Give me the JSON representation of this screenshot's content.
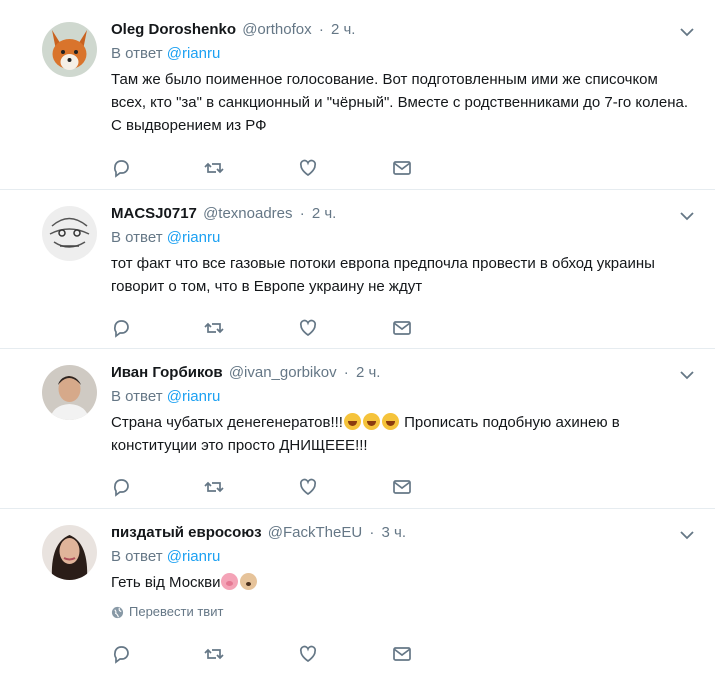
{
  "tweets": [
    {
      "name": "Oleg Doroshenko",
      "handle": "@orthofox",
      "time": "2 ч.",
      "reply_prefix": "В ответ",
      "reply_mention": "@rianru",
      "text": "Там же было поименное голосование. Вот подготовленным ими же списочком всех, кто \"за\" в санкционный и \"чёрный\". Вместе с родственниками до 7-го колена. С выдворением из РФ",
      "avatar": "fox-avatar"
    },
    {
      "name": "MACSJ0717",
      "handle": "@texnoadres",
      "time": "2 ч.",
      "reply_prefix": "В ответ",
      "reply_mention": "@rianru",
      "text": "тот факт что все газовые потоки европа предпочла провести в обход украины говорит о том, что в Европе украину не ждут",
      "avatar": "sketch-avatar"
    },
    {
      "name": "Иван Горбиков",
      "handle": "@ivan_gorbikov",
      "time": "2 ч.",
      "reply_prefix": "В ответ",
      "reply_mention": "@rianru",
      "text_part1": "Страна чубатых денегенератов!!!",
      "text_part2": " Прописать подобную ахинею в конституции это просто ДНИЩЕЕЕ!!!",
      "avatar": "man-avatar"
    },
    {
      "name": "пиздатый евросоюз",
      "handle": "@FackTheEU",
      "time": "3 ч.",
      "reply_prefix": "В ответ",
      "reply_mention": "@rianru",
      "text": "Геть від Москви",
      "translate_label": "Перевести твит",
      "avatar": "woman-avatar"
    }
  ],
  "icons": {
    "reply": "reply-icon",
    "retweet": "retweet-icon",
    "like": "heart-icon",
    "message": "envelope-icon",
    "more": "chevron-down-icon",
    "globe": "globe-icon"
  },
  "colors": {
    "link": "#1da1f2",
    "secondary": "#657786",
    "text": "#14171a",
    "divider": "#e6ecf0"
  }
}
